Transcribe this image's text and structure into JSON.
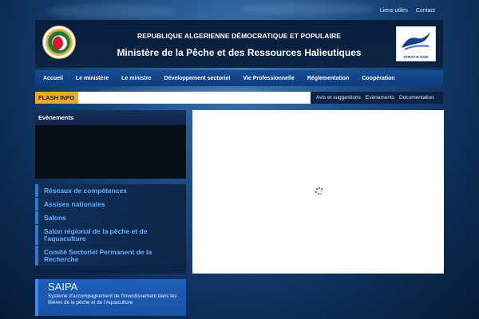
{
  "top_links": [
    "Liens utiles",
    "Contact"
  ],
  "header": {
    "line1": "REPUBLIQUE ALGERIENNE DÉMOCRATIQUE ET POPULAIRE",
    "line2": "Ministère de la Pêche et des Ressources Halieutiques",
    "logo_right_text": "STRAT-E-SAID"
  },
  "nav": [
    "Accueil",
    "Le ministère",
    "Le ministre",
    "Développement sectoriel",
    "Vie Professionnelle",
    "Réglementation",
    "Coopération"
  ],
  "flash": {
    "label": "FLASH INFO",
    "links": [
      "Avis et suggestions",
      "Evènements",
      "Documentation"
    ]
  },
  "events": {
    "title": "Evènements"
  },
  "side_links": [
    "Réseaux de compétences",
    "Assises nationales",
    "Salons",
    "Salon régional de la pêche et de l'aquaculture",
    "Comité Sectoriel Permanent de la Recherche"
  ],
  "saipa": {
    "title": "SAIPA",
    "description": "Système d'accompagnement de l'Investissement dans les filières de la pêche et de l'Aquaculture"
  },
  "colors": {
    "nav": "#164c96",
    "flash_label": "#f0a72a",
    "link": "#62b0ff",
    "saipa": "#1d5fb8"
  }
}
